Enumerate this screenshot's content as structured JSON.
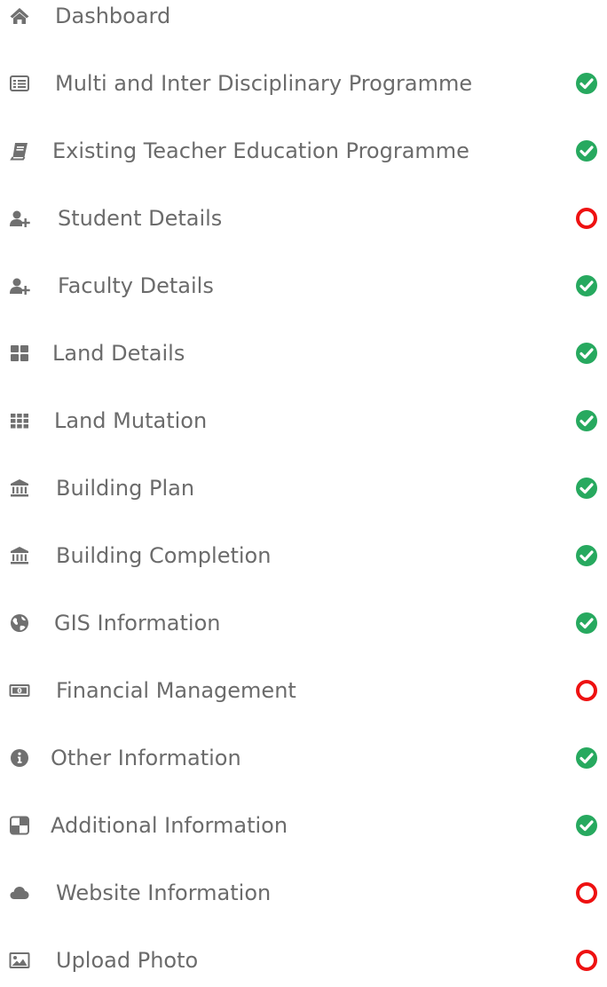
{
  "colors": {
    "text": "#6b6b6b",
    "icon": "#707070",
    "complete": "#27a95f",
    "incomplete": "#ee1111"
  },
  "menu": {
    "items": [
      {
        "label": "Dashboard",
        "icon": "home-icon",
        "status": null
      },
      {
        "label": "Multi and Inter Disciplinary Programme",
        "icon": "list-icon",
        "status": "complete"
      },
      {
        "label": "Existing Teacher Education Programme",
        "icon": "book-icon",
        "status": "complete"
      },
      {
        "label": "Student Details",
        "icon": "user-plus-icon",
        "status": "incomplete"
      },
      {
        "label": "Faculty Details",
        "icon": "user-plus-icon",
        "status": "complete"
      },
      {
        "label": "Land Details",
        "icon": "grid-icon",
        "status": "complete"
      },
      {
        "label": "Land Mutation",
        "icon": "apps-icon",
        "status": "complete"
      },
      {
        "label": "Building Plan",
        "icon": "bank-icon",
        "status": "complete"
      },
      {
        "label": "Building Completion",
        "icon": "bank-icon",
        "status": "complete"
      },
      {
        "label": "GIS Information",
        "icon": "globe-icon",
        "status": "complete"
      },
      {
        "label": "Financial Management",
        "icon": "money-icon",
        "status": "incomplete"
      },
      {
        "label": "Other Information",
        "icon": "info-icon",
        "status": "complete"
      },
      {
        "label": "Additional Information",
        "icon": "tiles-icon",
        "status": "complete"
      },
      {
        "label": "Website Information",
        "icon": "cloud-icon",
        "status": "incomplete"
      },
      {
        "label": "Upload Photo",
        "icon": "image-icon",
        "status": "incomplete"
      }
    ]
  }
}
